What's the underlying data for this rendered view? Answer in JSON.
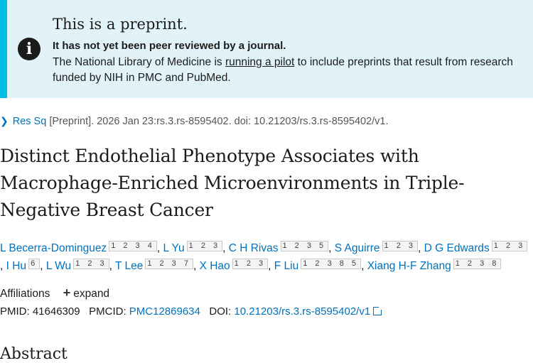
{
  "banner": {
    "title": "This is a preprint.",
    "strong": "It has not yet been peer reviewed by a journal.",
    "text_before": "The National Library of Medicine is ",
    "link": "running a pilot",
    "text_after": " to include preprints that result from research funded by NIH in PMC and PubMed."
  },
  "citation": {
    "journal": "Res Sq",
    "rest": "[Preprint]. 2026 Jan 23:rs.3.rs-8595402. doi: 10.21203/rs.3.rs-8595402/v1."
  },
  "title": "Distinct Endothelial Phenotype Associates with Macrophage-Enriched Microenvironments in Triple-Negative Breast Cancer",
  "authors": [
    {
      "name": "L Becerra-Dominguez",
      "aff": "1 2 3 4"
    },
    {
      "name": "L Yu",
      "aff": "1 2 3"
    },
    {
      "name": "C H Rivas",
      "aff": "1 2 3 5"
    },
    {
      "name": "S Aguirre",
      "aff": "1 2 3"
    },
    {
      "name": "D G Edwards",
      "aff": "1 2 3"
    },
    {
      "name": "I Hu",
      "aff": "6"
    },
    {
      "name": "L Wu",
      "aff": "1 2 3"
    },
    {
      "name": "T Lee",
      "aff": "1 2 3 7"
    },
    {
      "name": "X Hao",
      "aff": "1 2 3"
    },
    {
      "name": "F Liu",
      "aff": "1 2 3 8 5"
    },
    {
      "name": "Xiang H-F Zhang",
      "aff": "1 2 3 8"
    }
  ],
  "affiliations": {
    "label": "Affiliations",
    "expand": "expand"
  },
  "ids": {
    "pmid_label": "PMID:",
    "pmid": "41646309",
    "pmcid_label": "PMCID:",
    "pmcid": "PMC12869634",
    "doi_label": "DOI:",
    "doi": "10.21203/rs.3.rs-8595402/v1"
  },
  "abstract_heading": "Abstract",
  "colors": {
    "banner_bg": "#e1f3f8",
    "banner_accent": "#00bde3",
    "link": "#0071bc"
  }
}
